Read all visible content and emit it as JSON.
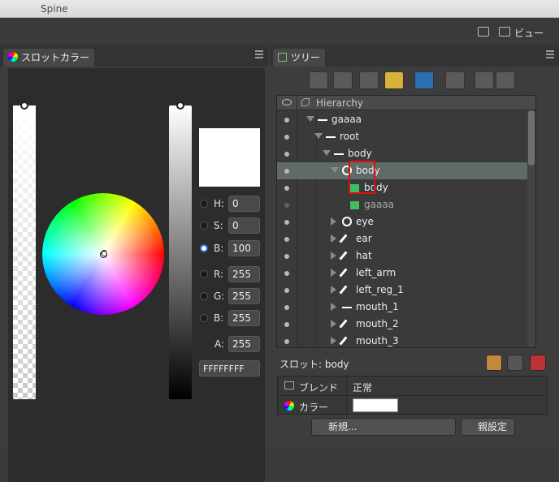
{
  "app": {
    "title": "Spine"
  },
  "toolbar": {
    "view_label": "ビュー"
  },
  "color_panel": {
    "tab_label": "スロットカラー",
    "fields": [
      {
        "label": "H:",
        "value": "0",
        "selected": false
      },
      {
        "label": "S:",
        "value": "0",
        "selected": false
      },
      {
        "label": "B:",
        "value": "100",
        "selected": true
      },
      {
        "label": "R:",
        "value": "255",
        "selected": false
      },
      {
        "label": "G:",
        "value": "255",
        "selected": false
      },
      {
        "label": "B:",
        "value": "255",
        "selected": false
      }
    ],
    "alpha": {
      "label": "A:",
      "value": "255"
    },
    "hex": "FFFFFFFF",
    "wheel_cursor_label": "C",
    "preview_color": "#ffffff"
  },
  "tree_panel": {
    "tab_label": "ツリー",
    "header": "Hierarchy",
    "rows": [
      {
        "label": "gaaaa",
        "icon": "skeleton-icon",
        "indent": 1,
        "arrow": "down",
        "dim": false
      },
      {
        "label": "root",
        "icon": "bone-icon",
        "indent": 2,
        "arrow": "down",
        "dim": false
      },
      {
        "label": "body",
        "icon": "bone-icon",
        "indent": 3,
        "arrow": "down",
        "dim": false
      },
      {
        "label": "body",
        "icon": "slot-icon",
        "indent": 4,
        "arrow": "down",
        "dim": false,
        "selected": true
      },
      {
        "label": "body",
        "icon": "attachment-icon",
        "indent": 5,
        "arrow": "",
        "dim": false
      },
      {
        "label": "gaaaa",
        "icon": "attachment-icon",
        "indent": 5,
        "arrow": "",
        "dim": true
      },
      {
        "label": "eye",
        "icon": "slot-icon",
        "indent": 4,
        "arrow": "right",
        "dim": false
      },
      {
        "label": "ear",
        "icon": "brush-icon",
        "indent": 4,
        "arrow": "right",
        "dim": false
      },
      {
        "label": "hat",
        "icon": "brush-icon",
        "indent": 4,
        "arrow": "right",
        "dim": false
      },
      {
        "label": "left_arm",
        "icon": "brush-icon",
        "indent": 4,
        "arrow": "right",
        "dim": false
      },
      {
        "label": "left_reg_1",
        "icon": "brush-icon",
        "indent": 4,
        "arrow": "right",
        "dim": false
      },
      {
        "label": "mouth_1",
        "icon": "bone-icon",
        "indent": 4,
        "arrow": "right",
        "dim": false
      },
      {
        "label": "mouth_2",
        "icon": "brush-icon",
        "indent": 4,
        "arrow": "right",
        "dim": false
      },
      {
        "label": "mouth_3",
        "icon": "brush-icon",
        "indent": 4,
        "arrow": "right",
        "dim": false
      }
    ],
    "slot_label": "スロット: body",
    "properties": {
      "blend_key": "ブレンド",
      "blend_value": "正常",
      "color_key": "カラー"
    },
    "new_button": "新規...",
    "parent_button": "親設定"
  }
}
